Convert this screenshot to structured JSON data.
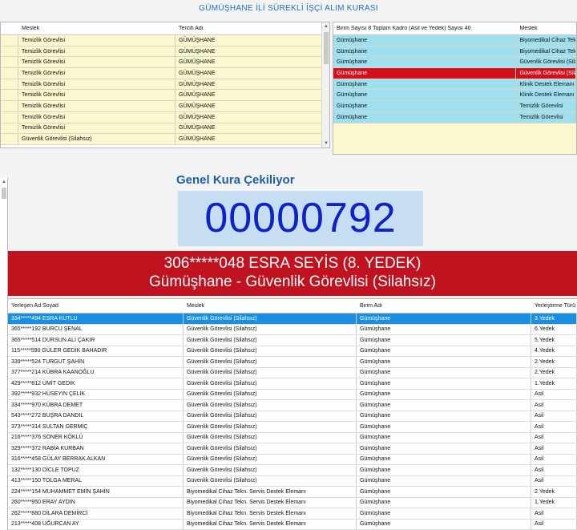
{
  "app": {
    "title": "GÜMÜŞHANE İLİ SÜREKLİ İŞÇİ ALIM KURASI"
  },
  "top_left": {
    "headers": [
      "",
      "Meslek",
      "Tercih Adı"
    ],
    "rows": [
      {
        "meslek": "Temizlik Görevlisi",
        "tercih": "GÜMÜŞHANE"
      },
      {
        "meslek": "Temizlik Görevlisi",
        "tercih": "GÜMÜŞHANE"
      },
      {
        "meslek": "Temizlik Görevlisi",
        "tercih": "GÜMÜŞHANE"
      },
      {
        "meslek": "Temizlik Görevlisi",
        "tercih": "GÜMÜŞHANE"
      },
      {
        "meslek": "Temizlik Görevlisi",
        "tercih": "GÜMÜŞHANE"
      },
      {
        "meslek": "Temizlik Görevlisi",
        "tercih": "GÜMÜŞHANE"
      },
      {
        "meslek": "Temizlik Görevlisi",
        "tercih": "GÜMÜŞHANE"
      },
      {
        "meslek": "Temizlik Görevlisi",
        "tercih": "GÜMÜŞHANE"
      },
      {
        "meslek": "Temizlik Görevlisi",
        "tercih": "GÜMÜŞHANE"
      },
      {
        "meslek": "Güvenlik Görevlisi (Silahsız)",
        "tercih": "GÜMÜŞHANE"
      }
    ]
  },
  "top_right": {
    "headers": [
      "Birim Sayısı 8 Toplam Kadro (Asil ve Yedek) Sayısı 40",
      "Meslek"
    ],
    "rows": [
      {
        "birim": "Gümüşhane",
        "meslek": "Biyomedikal Cihaz Tekn."
      },
      {
        "birim": "Gümüşhane",
        "meslek": "Biyomedikal Cihaz Tekn."
      },
      {
        "birim": "Gümüşhane",
        "meslek": "Güvenlik Görevlisi (Silah"
      },
      {
        "birim": "Gümüşhane",
        "meslek": "Güvenlik Görevlisi (Silahsı"
      },
      {
        "birim": "Gümüşhane",
        "meslek": "Klinik Destek Elemanı (H"
      },
      {
        "birim": "Gümüşhane",
        "meslek": "Klinik Destek Elemanı (H"
      },
      {
        "birim": "Gümüşhane",
        "meslek": "Temizlik Görevlisi"
      },
      {
        "birim": "Gümüşhane",
        "meslek": "Temizlik Görevlisi"
      }
    ],
    "selected_index": 3
  },
  "draw": {
    "title": "Genel Kura Çekiliyor",
    "counter": "00000792",
    "winner_line1": "306*****048 ESRA SEYİS (8. YEDEK)",
    "winner_line2": "Gümüşhane - Güvenlik Görevlisi (Silahsız)"
  },
  "bottom": {
    "headers": [
      "Yerleşen Ad Soyad",
      "Meslek",
      "Birim Adı",
      "Yerleştirme Türü"
    ],
    "rows": [
      {
        "ad": "334*****494 ESRA KUTLU",
        "meslek": "Güvenlik Görevlisi (Silahsız)",
        "birim": "Gümüşhane",
        "tur": "3.Yedek"
      },
      {
        "ad": "365*****192 BURCU ŞENAL",
        "meslek": "Güvenlik Görevlisi (Silahsız)",
        "birim": "Gümüşhane",
        "tur": "6.Yedek"
      },
      {
        "ad": "365*****514 DURSUN ALİ ÇAKIR",
        "meslek": "Güvenlik Görevlisi (Silahsız)",
        "birim": "Gümüşhane",
        "tur": "5.Yedek"
      },
      {
        "ad": "115*****590 GÜLER GEDİK BAHADIR",
        "meslek": "Güvenlik Görevlisi (Silahsız)",
        "birim": "Gümüşhane",
        "tur": "4.Yedek"
      },
      {
        "ad": "339*****524 TURGUT ŞAHİN",
        "meslek": "Güvenlik Görevlisi (Silahsız)",
        "birim": "Gümüşhane",
        "tur": "2.Yedek"
      },
      {
        "ad": "377*****214 KÜBRA KAANOĞLU",
        "meslek": "Güvenlik Görevlisi (Silahsız)",
        "birim": "Gümüşhane",
        "tur": "2.Yedek"
      },
      {
        "ad": "429*****812 ÜMİT GEDİK",
        "meslek": "Güvenlik Görevlisi (Silahsız)",
        "birim": "Gümüşhane",
        "tur": "1.Yedek"
      },
      {
        "ad": "392*****932 HÜSEYİN ÇELİK",
        "meslek": "Güvenlik Görevlisi (Silahsız)",
        "birim": "Gümüşhane",
        "tur": "Asil"
      },
      {
        "ad": "334*****970 KÜBRA DEMET",
        "meslek": "Güvenlik Görevlisi (Silahsız)",
        "birim": "Gümüşhane",
        "tur": "Asil"
      },
      {
        "ad": "543*****272 BUŞRA DANDIL",
        "meslek": "Güvenlik Görevlisi (Silahsız)",
        "birim": "Gümüşhane",
        "tur": "Asil"
      },
      {
        "ad": "373*****314 SULTAN GERMİÇ",
        "meslek": "Güvenlik Görevlisi (Silahsız)",
        "birim": "Gümüşhane",
        "tur": "Asil"
      },
      {
        "ad": "216*****376 SONER KÖKLÜ",
        "meslek": "Güvenlik Görevlisi (Silahsız)",
        "birim": "Gümüşhane",
        "tur": "Asil"
      },
      {
        "ad": "329*****372 RABİA KURBAN",
        "meslek": "Güvenlik Görevlisi (Silahsız)",
        "birim": "Gümüşhane",
        "tur": "Asil"
      },
      {
        "ad": "316*****458 GÜLAY BERRAK ALKAN",
        "meslek": "Güvenlik Görevlisi (Silahsız)",
        "birim": "Gümüşhane",
        "tur": "Asil"
      },
      {
        "ad": "132*****130 DİCLE TOPUZ",
        "meslek": "Güvenlik Görevlisi (Silahsız)",
        "birim": "Gümüşhane",
        "tur": "Asil"
      },
      {
        "ad": "413*****150 TOLGA MERAL",
        "meslek": "Güvenlik Görevlisi (Silahsız)",
        "birim": "Gümüşhane",
        "tur": "Asil"
      },
      {
        "ad": "224*****154 MUHAMMET EMİN ŞAHİN",
        "meslek": "Biyomedikal Cihaz Tekn. Servis Destek Elemanı",
        "birim": "Gümüşhane",
        "tur": "2.Yedek"
      },
      {
        "ad": "260*****950 ERAY AYDIN",
        "meslek": "Biyomedikal Cihaz Tekn. Servis Destek Elemanı",
        "birim": "Gümüşhane",
        "tur": "1.Yedek"
      },
      {
        "ad": "262*****880 DİLARA DEMİRCİ",
        "meslek": "Biyomedikal Cihaz Tekn. Servis Destek Elemanı",
        "birim": "Gümüşhane",
        "tur": "Asil"
      },
      {
        "ad": "213*****408 UĞURCAN AY",
        "meslek": "Biyomedikal Cihaz Tekn. Servis Destek Elemanı",
        "birim": "Gümüşhane",
        "tur": "Asil"
      }
    ],
    "selected_index": 0
  }
}
